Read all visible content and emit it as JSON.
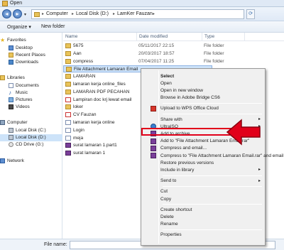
{
  "window": {
    "title": "Open"
  },
  "address": {
    "crumbs": [
      "Computer",
      "Local Disk (D:)",
      "LamKer Fauzan"
    ]
  },
  "toolbar": {
    "organize": "Organize ▾",
    "new_folder": "New folder"
  },
  "sidebar": {
    "favorites": "Favorites",
    "fav_items": [
      "Desktop",
      "Recent Places",
      "Downloads"
    ],
    "libraries": "Libraries",
    "lib_items": [
      "Documents",
      "Music",
      "Pictures",
      "Videos"
    ],
    "computer": "Computer",
    "comp_items": [
      "Local Disk (C:)",
      "Local Disk (D:)",
      "CD Drive (G:)"
    ],
    "network": "Network"
  },
  "columns": {
    "name": "Name",
    "date": "Date modified",
    "type": "Type"
  },
  "files": [
    {
      "name": "5675",
      "date": "05/11/2017 22:15",
      "type": "File folder",
      "icon": "folder"
    },
    {
      "name": "Aan",
      "date": "20/03/2017 18:57",
      "type": "File folder",
      "icon": "folder"
    },
    {
      "name": "compress",
      "date": "07/04/2017 11:25",
      "type": "File folder",
      "icon": "folder"
    },
    {
      "name": "File Attachment Lamaran Email",
      "date": "",
      "type": "",
      "icon": "folder"
    },
    {
      "name": "LAMARAN",
      "date": "",
      "type": "",
      "icon": "folder"
    },
    {
      "name": "lamaran kerja online_files",
      "date": "",
      "type": "",
      "icon": "folder"
    },
    {
      "name": "LAMARAN PDF PECAHAN",
      "date": "",
      "type": "",
      "icon": "folder"
    },
    {
      "name": "Lampiran doc krj lewat email",
      "date": "",
      "type": "",
      "icon": "pdf"
    },
    {
      "name": "loker",
      "date": "",
      "type": "",
      "icon": "folder"
    },
    {
      "name": "CV Fauzan",
      "date": "",
      "type": "",
      "icon": "pdf"
    },
    {
      "name": "lamaran kerja online",
      "date": "",
      "type": "",
      "icon": "doc"
    },
    {
      "name": "Login",
      "date": "",
      "type": "",
      "icon": "doc"
    },
    {
      "name": "meja",
      "date": "",
      "type": "",
      "icon": "doc"
    },
    {
      "name": "surat lamaran 1.part1",
      "date": "",
      "type": "",
      "icon": "rar"
    },
    {
      "name": "surat lamaran 1",
      "date": "",
      "type": "",
      "icon": "rar"
    }
  ],
  "context_menu": {
    "items": [
      {
        "label": "Select",
        "bold": true
      },
      {
        "label": "Open"
      },
      {
        "label": "Open in new window"
      },
      {
        "label": "Browse in Adobe Bridge CS6"
      },
      {
        "sep": true
      },
      {
        "label": "Upload to WPS Office Cloud",
        "icon": "wps"
      },
      {
        "sep": true
      },
      {
        "label": "Share with",
        "submenu": true
      },
      {
        "label": "UltraISO",
        "submenu": true,
        "icon": "iso"
      },
      {
        "label": "Add to archive...",
        "icon": "rar"
      },
      {
        "label": "Add to \"File Attachment Lamaran Email.rar\"",
        "icon": "rar"
      },
      {
        "label": "Compress and email...",
        "icon": "rar",
        "highlight": true
      },
      {
        "label": "Compress to \"File Attachment Lamaran Email.rar\" and email",
        "icon": "rar"
      },
      {
        "label": "Restore previous versions"
      },
      {
        "label": "Include in library",
        "submenu": true
      },
      {
        "sep": true
      },
      {
        "label": "Send to",
        "submenu": true
      },
      {
        "sep": true
      },
      {
        "label": "Cut"
      },
      {
        "label": "Copy"
      },
      {
        "sep": true
      },
      {
        "label": "Create shortcut"
      },
      {
        "label": "Delete"
      },
      {
        "label": "Rename"
      },
      {
        "sep": true
      },
      {
        "label": "Properties"
      }
    ]
  },
  "bottom": {
    "file_name_label": "File name:"
  }
}
